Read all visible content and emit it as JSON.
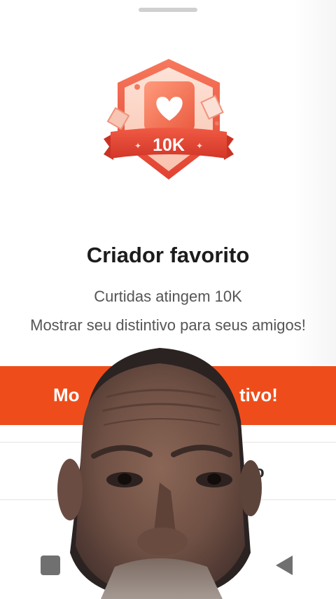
{
  "colors": {
    "accent": "#ee4d1b",
    "badge_red": "#e8483a",
    "badge_light": "#f7a68f",
    "title_text": "#1c1c1c",
    "body_text": "#555555"
  },
  "badge": {
    "value": "10K",
    "icon": "heart-icon"
  },
  "title": "Criador favorito",
  "subtitle": "Curtidas atingem 10K",
  "description": "Mostrar seu distintivo para seus amigos!",
  "cta": {
    "label_left": "Mo",
    "label_right": "tivo!"
  },
  "secondary": {
    "label_fragment": "o"
  },
  "nav": {
    "recents": "square-icon",
    "home": "circle-icon",
    "back": "triangle-back-icon"
  }
}
